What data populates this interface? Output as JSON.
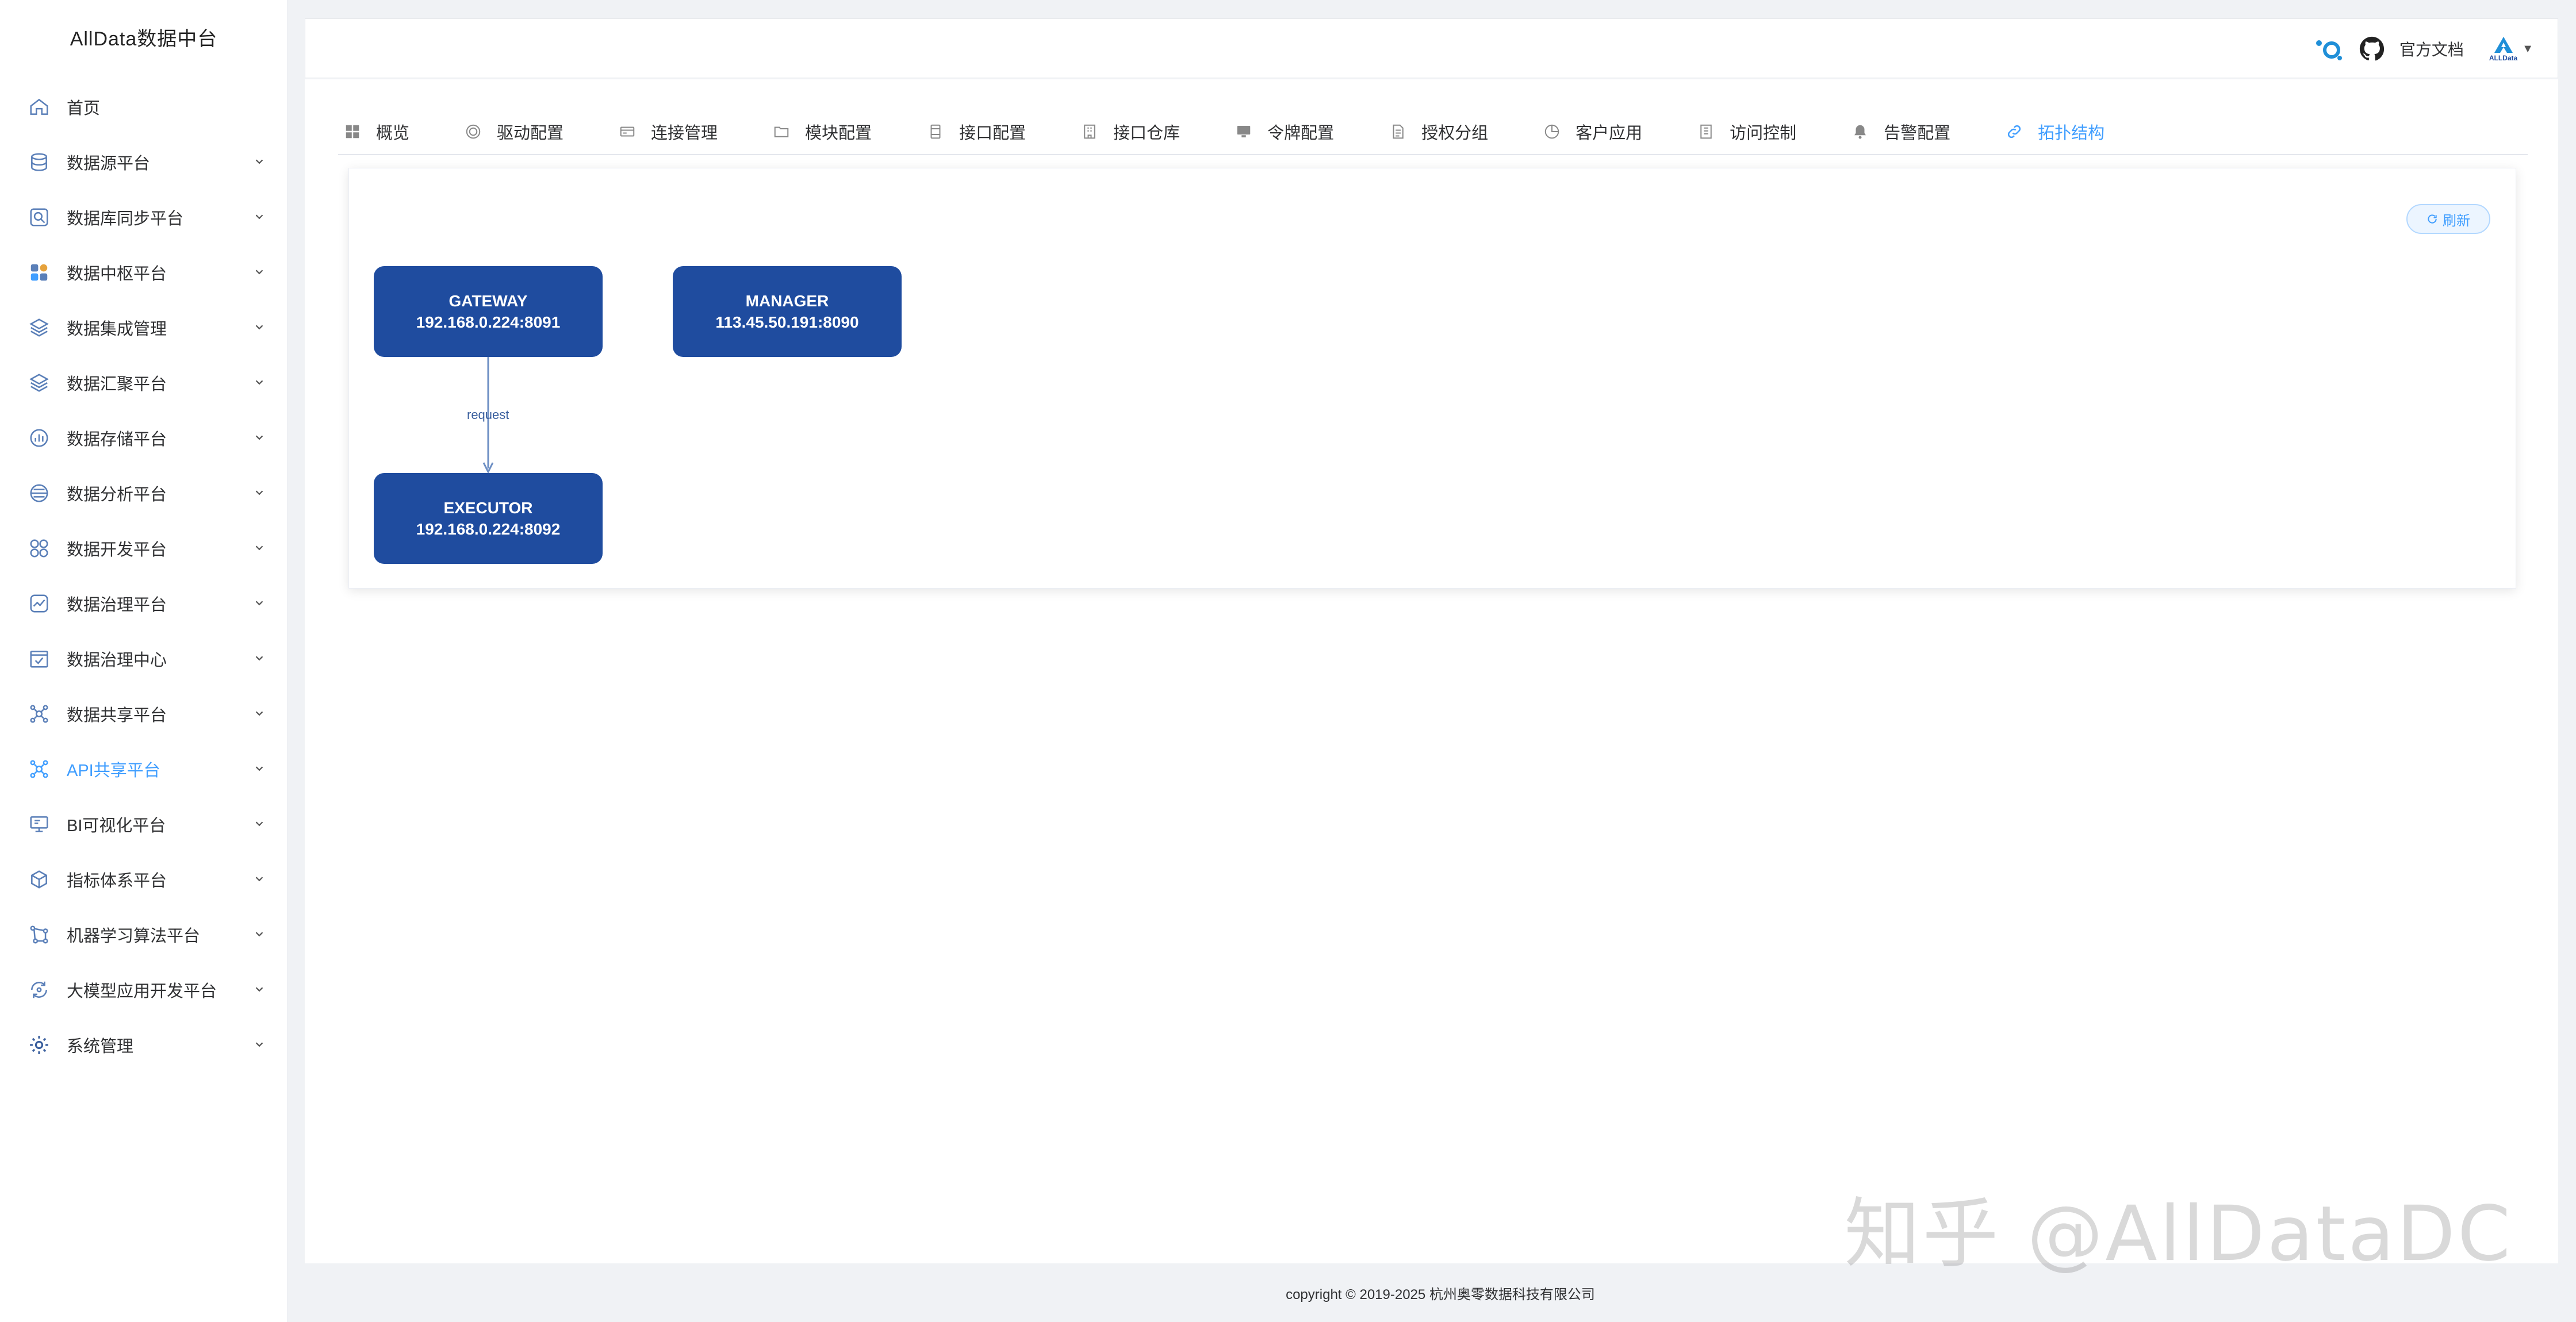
{
  "app": {
    "title": "AllData数据中台"
  },
  "sidebar": {
    "items": [
      {
        "label": "首页",
        "icon": "home-icon"
      },
      {
        "label": "数据源平台",
        "icon": "database-icon"
      },
      {
        "label": "数据库同步平台",
        "icon": "sync-icon"
      },
      {
        "label": "数据中枢平台",
        "icon": "hub-icon"
      },
      {
        "label": "数据集成管理",
        "icon": "layers-icon"
      },
      {
        "label": "数据汇聚平台",
        "icon": "layers-icon"
      },
      {
        "label": "数据存储平台",
        "icon": "storage-icon"
      },
      {
        "label": "数据分析平台",
        "icon": "analysis-icon"
      },
      {
        "label": "数据开发平台",
        "icon": "grid-icon"
      },
      {
        "label": "数据治理平台",
        "icon": "chart-icon"
      },
      {
        "label": "数据治理中心",
        "icon": "check-calendar-icon"
      },
      {
        "label": "数据共享平台",
        "icon": "share-icon"
      },
      {
        "label": "API共享平台",
        "icon": "share-icon",
        "active": true
      },
      {
        "label": "BI可视化平台",
        "icon": "monitor-icon"
      },
      {
        "label": "指标体系平台",
        "icon": "cube-icon"
      },
      {
        "label": "机器学习算法平台",
        "icon": "ml-icon"
      },
      {
        "label": "大模型应用开发平台",
        "icon": "refresh-circle-icon"
      },
      {
        "label": "系统管理",
        "icon": "settings-icon"
      }
    ]
  },
  "header": {
    "docs_label": "官方文档",
    "brand_label": "ALLData",
    "dropdown_arrow": "▼"
  },
  "tabs": [
    {
      "label": "概览",
      "icon": "dashboard-icon"
    },
    {
      "label": "驱动配置",
      "icon": "driver-icon"
    },
    {
      "label": "连接管理",
      "icon": "card-icon"
    },
    {
      "label": "模块配置",
      "icon": "folder-icon"
    },
    {
      "label": "接口配置",
      "icon": "file-icon"
    },
    {
      "label": "接口仓库",
      "icon": "building-icon"
    },
    {
      "label": "令牌配置",
      "icon": "monitor-icon"
    },
    {
      "label": "授权分组",
      "icon": "document-icon"
    },
    {
      "label": "客户应用",
      "icon": "pie-icon"
    },
    {
      "label": "访问控制",
      "icon": "list-icon"
    },
    {
      "label": "告警配置",
      "icon": "bell-icon"
    },
    {
      "label": "拓扑结构",
      "icon": "link-icon",
      "active": true
    }
  ],
  "topology": {
    "refresh_label": "刷新",
    "nodes": [
      {
        "name": "GATEWAY",
        "address": "192.168.0.224:8091"
      },
      {
        "name": "MANAGER",
        "address": "113.45.50.191:8090"
      },
      {
        "name": "EXECUTOR",
        "address": "192.168.0.224:8092"
      }
    ],
    "edge_label": "request"
  },
  "footer": {
    "copyright": "copyright © 2019-2025 杭州奥零数据科技有限公司"
  },
  "watermark": "知乎 @AllDataDC",
  "colors": {
    "accent": "#409eff",
    "node": "#1f4c9f"
  }
}
